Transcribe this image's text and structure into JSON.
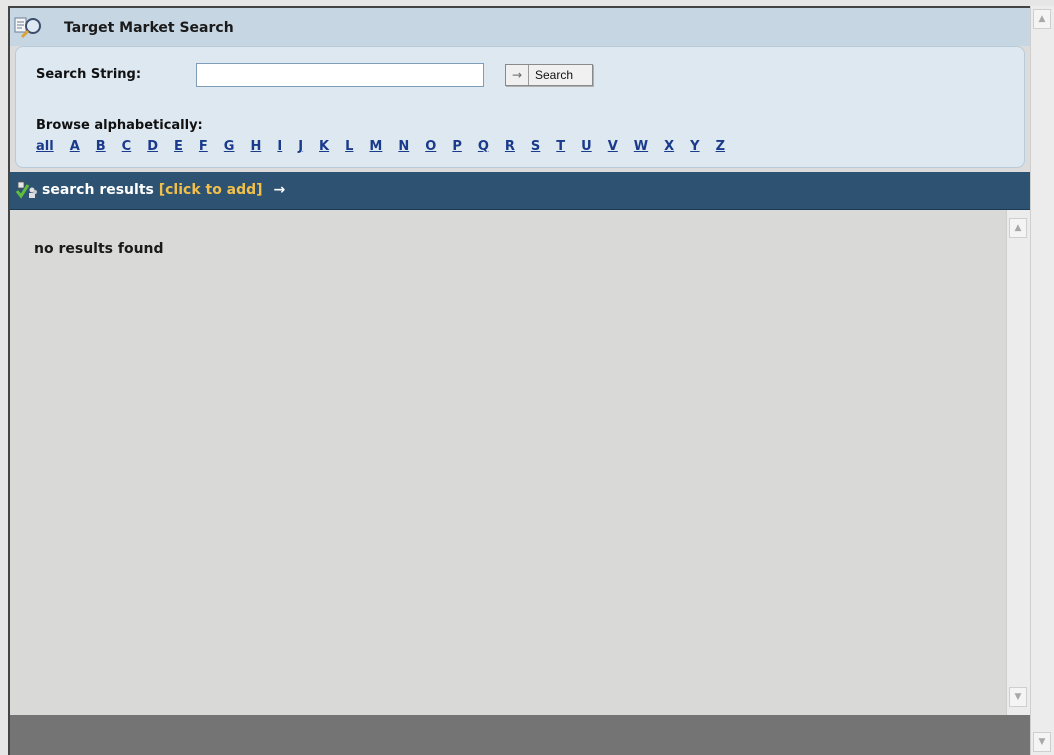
{
  "window": {
    "title": "Target Market Search",
    "title_icon": "search-document-icon"
  },
  "search": {
    "label": "Search String:",
    "input_value": "",
    "button_arrow": "→",
    "button_label": "Search"
  },
  "browse": {
    "label": "Browse alphabetically:",
    "letters": [
      "all",
      "A",
      "B",
      "C",
      "D",
      "E",
      "F",
      "G",
      "H",
      "I",
      "J",
      "K",
      "L",
      "M",
      "N",
      "O",
      "P",
      "Q",
      "R",
      "S",
      "T",
      "U",
      "V",
      "W",
      "X",
      "Y",
      "Z"
    ]
  },
  "results": {
    "icon": "checkmark-people-icon",
    "title": "search results",
    "add_link": "[click to add]",
    "arrow": "→",
    "empty_message": "no results found"
  },
  "scrollbar": {
    "up": "▲",
    "down": "▼"
  },
  "colors": {
    "title_bar": "#c7d6e3",
    "results_bar": "#2d5272",
    "link": "#1a3a8a",
    "add_link": "#f2c04a"
  }
}
